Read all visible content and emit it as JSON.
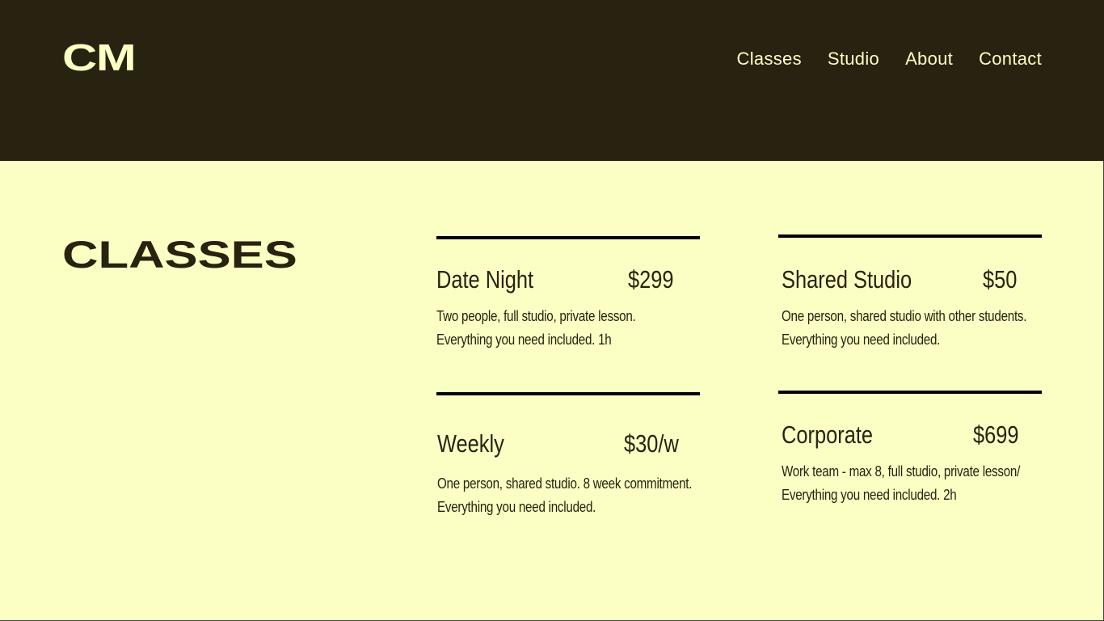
{
  "header": {
    "logo": "CM",
    "nav": [
      {
        "label": "Classes"
      },
      {
        "label": "Studio"
      },
      {
        "label": "About"
      },
      {
        "label": "Contact"
      }
    ]
  },
  "main": {
    "title": "CLASSES",
    "classes": [
      {
        "name": "Date Night",
        "price": "$299",
        "description_line1": "Two people, full studio, private lesson.",
        "description_line2": "Everything you need included. 1h"
      },
      {
        "name": "Shared Studio",
        "price": "$50",
        "description_line1": "One person, shared studio with other students.",
        "description_line2": "Everything you need included."
      },
      {
        "name": "Weekly",
        "price": "$30/w",
        "description_line1": "One person, shared studio. 8 week commitment.",
        "description_line2": "Everything you need included."
      },
      {
        "name": "Corporate",
        "price": "$699",
        "description_line1": "Work team - max 8, full studio, private lesson/",
        "description_line2": "Everything you need included. 2h"
      }
    ]
  },
  "colors": {
    "header_bg": "#282210",
    "page_bg": "#fcffc4",
    "text_dark": "#28220f",
    "text_light": "#fcffc4"
  }
}
